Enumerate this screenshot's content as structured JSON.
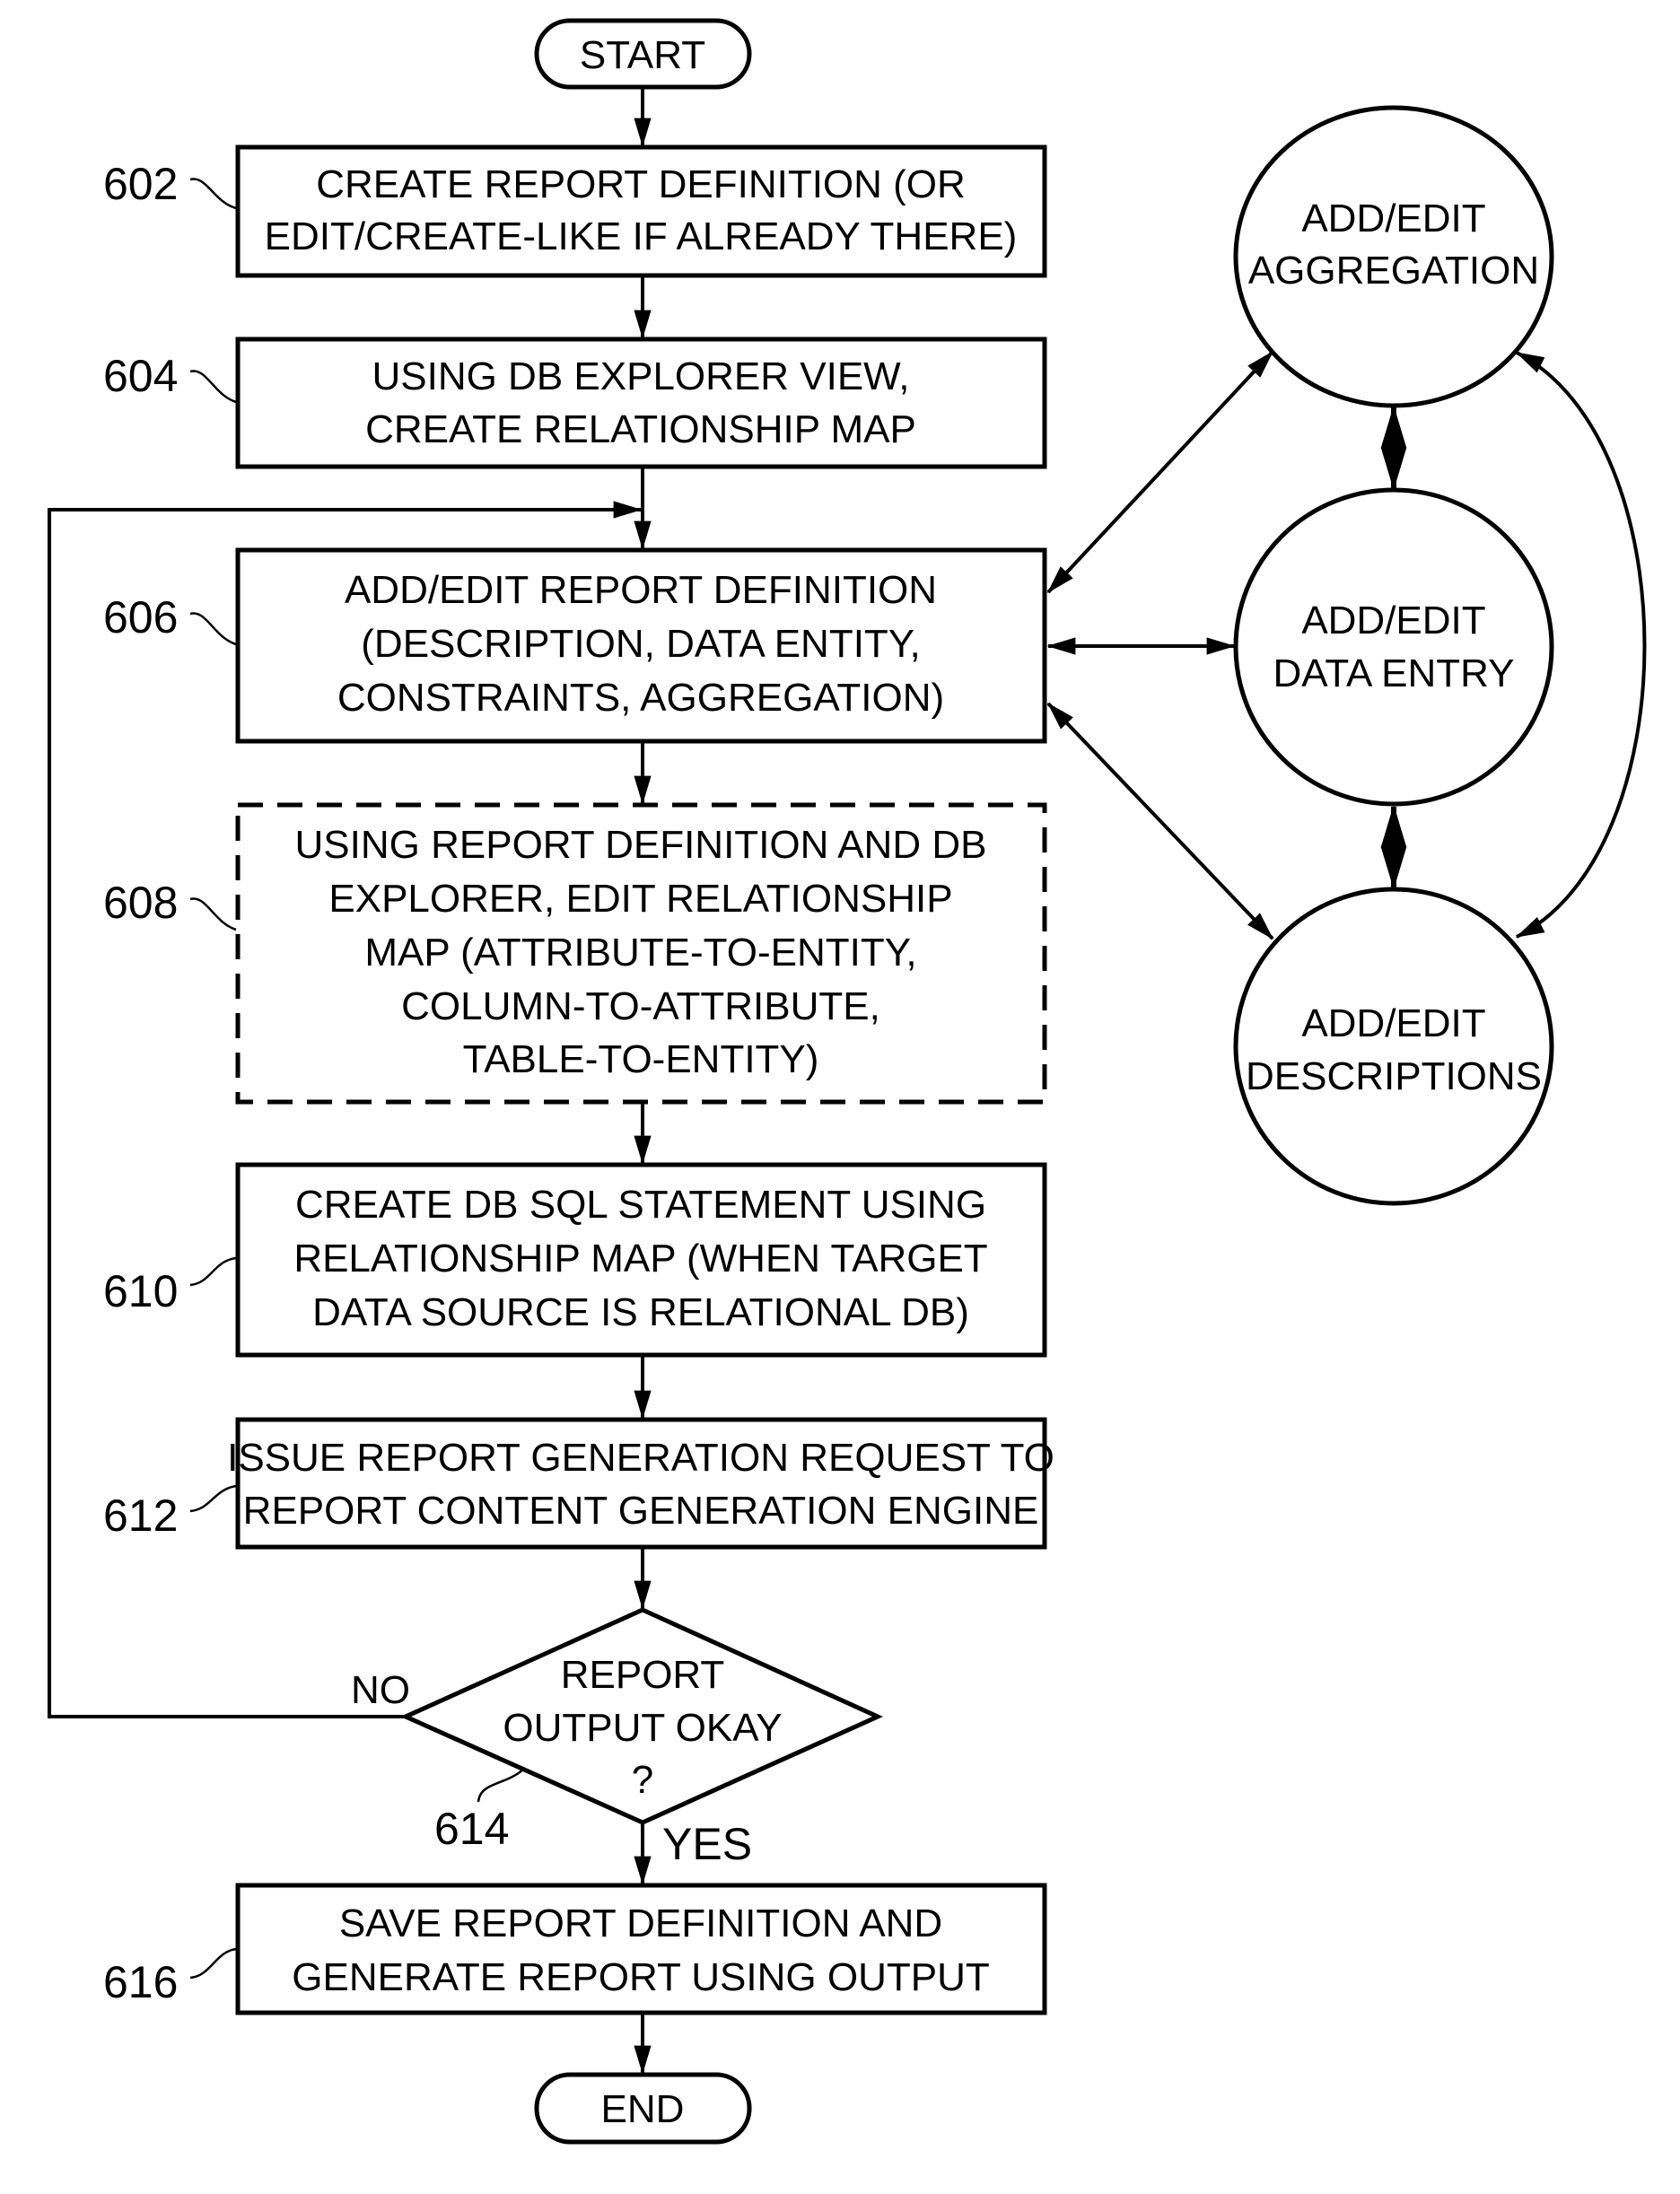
{
  "diagram": {
    "type": "flowchart",
    "terminals": {
      "start": "START",
      "end": "END"
    },
    "steps": [
      {
        "ref": "602",
        "lines": [
          "CREATE REPORT DEFINITION (OR",
          "EDIT/CREATE-LIKE IF ALREADY THERE)"
        ],
        "style": "solid"
      },
      {
        "ref": "604",
        "lines": [
          "USING DB EXPLORER VIEW,",
          "CREATE RELATIONSHIP MAP"
        ],
        "style": "solid"
      },
      {
        "ref": "606",
        "lines": [
          "ADD/EDIT REPORT DEFINITION",
          "(DESCRIPTION, DATA ENTITY,",
          "CONSTRAINTS, AGGREGATION)"
        ],
        "style": "solid"
      },
      {
        "ref": "608",
        "lines": [
          "USING REPORT DEFINITION AND DB",
          "EXPLORER, EDIT RELATIONSHIP",
          "MAP (ATTRIBUTE-TO-ENTITY,",
          "COLUMN-TO-ATTRIBUTE,",
          "TABLE-TO-ENTITY)"
        ],
        "style": "dashed"
      },
      {
        "ref": "610",
        "lines": [
          "CREATE DB SQL STATEMENT USING",
          "RELATIONSHIP MAP (WHEN TARGET",
          "DATA SOURCE IS RELATIONAL DB)"
        ],
        "style": "solid"
      },
      {
        "ref": "612",
        "lines": [
          "ISSUE REPORT GENERATION REQUEST TO",
          "REPORT CONTENT GENERATION ENGINE"
        ],
        "style": "solid"
      },
      {
        "ref": "616",
        "lines": [
          "SAVE REPORT DEFINITION AND",
          "GENERATE REPORT USING OUTPUT"
        ],
        "style": "solid"
      }
    ],
    "decision": {
      "ref": "614",
      "lines": [
        "REPORT",
        "OUTPUT OKAY",
        "?"
      ],
      "no_label": "NO",
      "yes_label": "YES"
    },
    "side_nodes": [
      {
        "lines": [
          "ADD/EDIT",
          "AGGREGATION"
        ]
      },
      {
        "lines": [
          "ADD/EDIT",
          "DATA ENTRY"
        ]
      },
      {
        "lines": [
          "ADD/EDIT",
          "DESCRIPTIONS"
        ]
      }
    ]
  }
}
